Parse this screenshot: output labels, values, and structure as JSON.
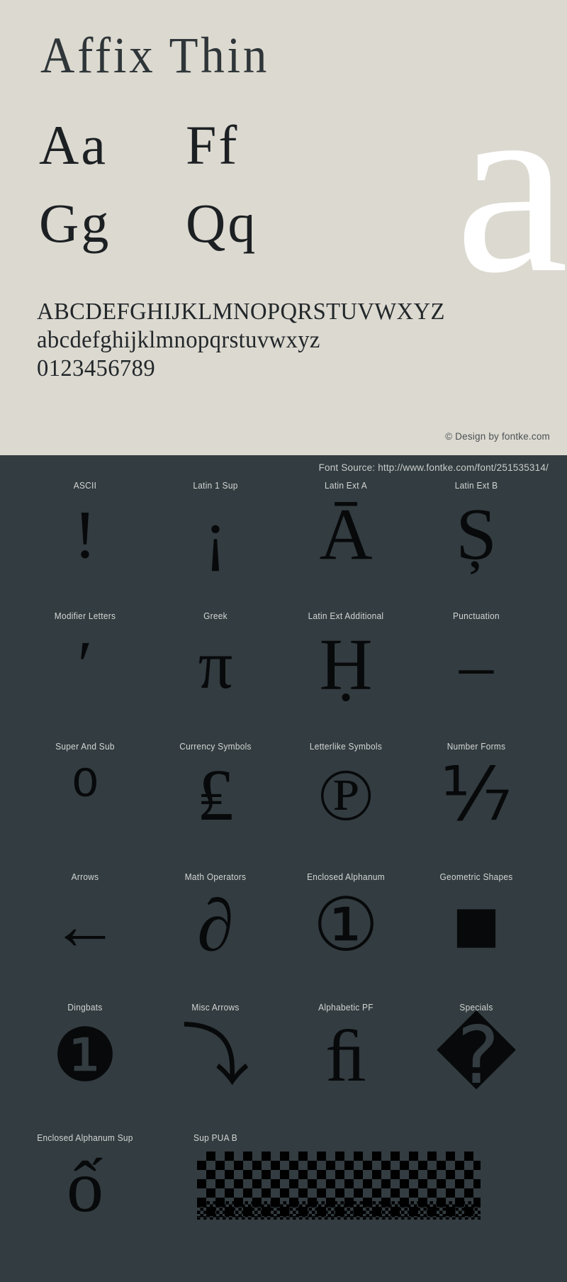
{
  "specimen": {
    "title": "Affix Thin",
    "hero_glyph": "a",
    "glyph_pairs": [
      {
        "left": "Aa",
        "right": "Ff"
      },
      {
        "left": "Gg",
        "right": "Qq"
      }
    ],
    "alphabet_uppercase": "ABCDEFGHIJKLMNOPQRSTUVWXYZ",
    "alphabet_lowercase": "abcdefghijklmnopqrstuvwxyz",
    "digits": "0123456789",
    "copyright": "© Design by fontke.com",
    "font_source": "Font Source: http://www.fontke.com/font/251535314/"
  },
  "unicode_blocks": {
    "rows": [
      [
        {
          "label": "ASCII",
          "glyph": "!"
        },
        {
          "label": "Latin 1 Sup",
          "glyph": "¡"
        },
        {
          "label": "Latin Ext A",
          "glyph": "Ā"
        },
        {
          "label": "Latin Ext B",
          "glyph": "Ș"
        }
      ],
      [
        {
          "label": "Modifier Letters",
          "glyph": "ʹ"
        },
        {
          "label": "Greek",
          "glyph": "π"
        },
        {
          "label": "Latin Ext Additional",
          "glyph": "Ḥ"
        },
        {
          "label": "Punctuation",
          "glyph": "–"
        }
      ],
      [
        {
          "label": "Super And Sub",
          "glyph": "⁰"
        },
        {
          "label": "Currency Symbols",
          "glyph": "₤"
        },
        {
          "label": "Letterlike Symbols",
          "glyph": "℗"
        },
        {
          "label": "Number Forms",
          "glyph": "⅐"
        }
      ],
      [
        {
          "label": "Arrows",
          "glyph": "←"
        },
        {
          "label": "Math Operators",
          "glyph": "∂"
        },
        {
          "label": "Enclosed Alphanum",
          "glyph": "①"
        },
        {
          "label": "Geometric Shapes",
          "glyph": "■"
        }
      ],
      [
        {
          "label": "Dingbats",
          "glyph": "❶"
        },
        {
          "label": "Misc Arrows",
          "glyph": "⤵"
        },
        {
          "label": "Alphabetic PF",
          "glyph": "ﬁ"
        },
        {
          "label": "Specials",
          "glyph": "�"
        }
      ],
      [
        {
          "label": "Enclosed Alphanum Sup",
          "glyph": "ố"
        },
        {
          "label": "Sup PUA B",
          "glyph": ""
        }
      ]
    ]
  },
  "colors": {
    "top_background": "#dcd9d0",
    "dark_background": "#333c40",
    "glyph_ink": "#1c2023",
    "hero_glyph": "#ffffff",
    "label_text": "#d3d6d4"
  }
}
